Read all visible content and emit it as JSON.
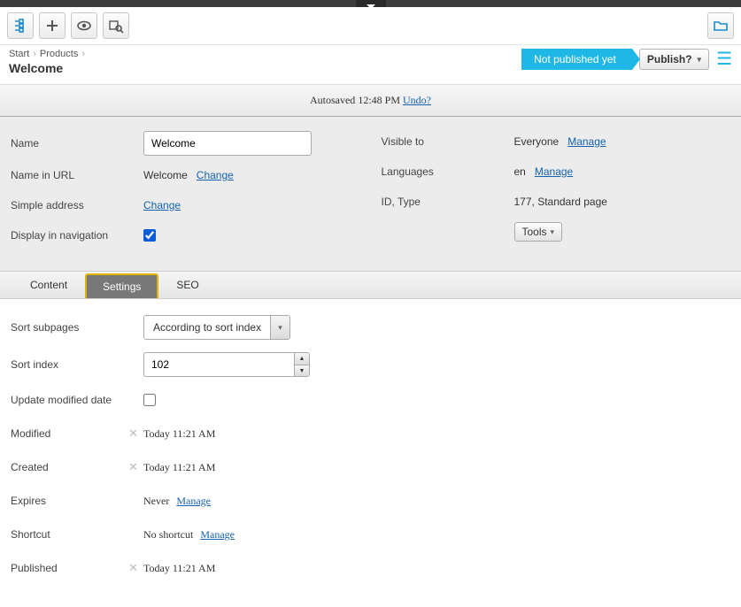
{
  "breadcrumb": {
    "start": "Start",
    "products": "Products"
  },
  "page_title": "Welcome",
  "status": "Not published yet",
  "publish_label": "Publish?",
  "autosave": {
    "prefix": "Autosaved",
    "time": "12:48 PM",
    "undo": "Undo?"
  },
  "props_left": {
    "name_label": "Name",
    "name_value": "Welcome",
    "url_label": "Name in URL",
    "url_value": "Welcome",
    "url_change": "Change",
    "simple_label": "Simple address",
    "simple_change": "Change",
    "nav_label": "Display in navigation"
  },
  "props_right": {
    "visible_label": "Visible to",
    "visible_value": "Everyone",
    "visible_manage": "Manage",
    "lang_label": "Languages",
    "lang_value": "en",
    "lang_manage": "Manage",
    "idtype_label": "ID, Type",
    "idtype_value": "177, Standard page",
    "tools_label": "Tools"
  },
  "tabs": {
    "content": "Content",
    "settings": "Settings",
    "seo": "SEO"
  },
  "settings": {
    "sort_subpages_label": "Sort subpages",
    "sort_subpages_value": "According to sort index",
    "sort_index_label": "Sort index",
    "sort_index_value": "102",
    "update_modified_label": "Update modified date",
    "modified_label": "Modified",
    "modified_value": "Today 11:21 AM",
    "created_label": "Created",
    "created_value": "Today 11:21 AM",
    "expires_label": "Expires",
    "expires_value": "Never",
    "expires_manage": "Manage",
    "shortcut_label": "Shortcut",
    "shortcut_value": "No shortcut",
    "shortcut_manage": "Manage",
    "published_label": "Published",
    "published_value": "Today 11:21 AM"
  }
}
